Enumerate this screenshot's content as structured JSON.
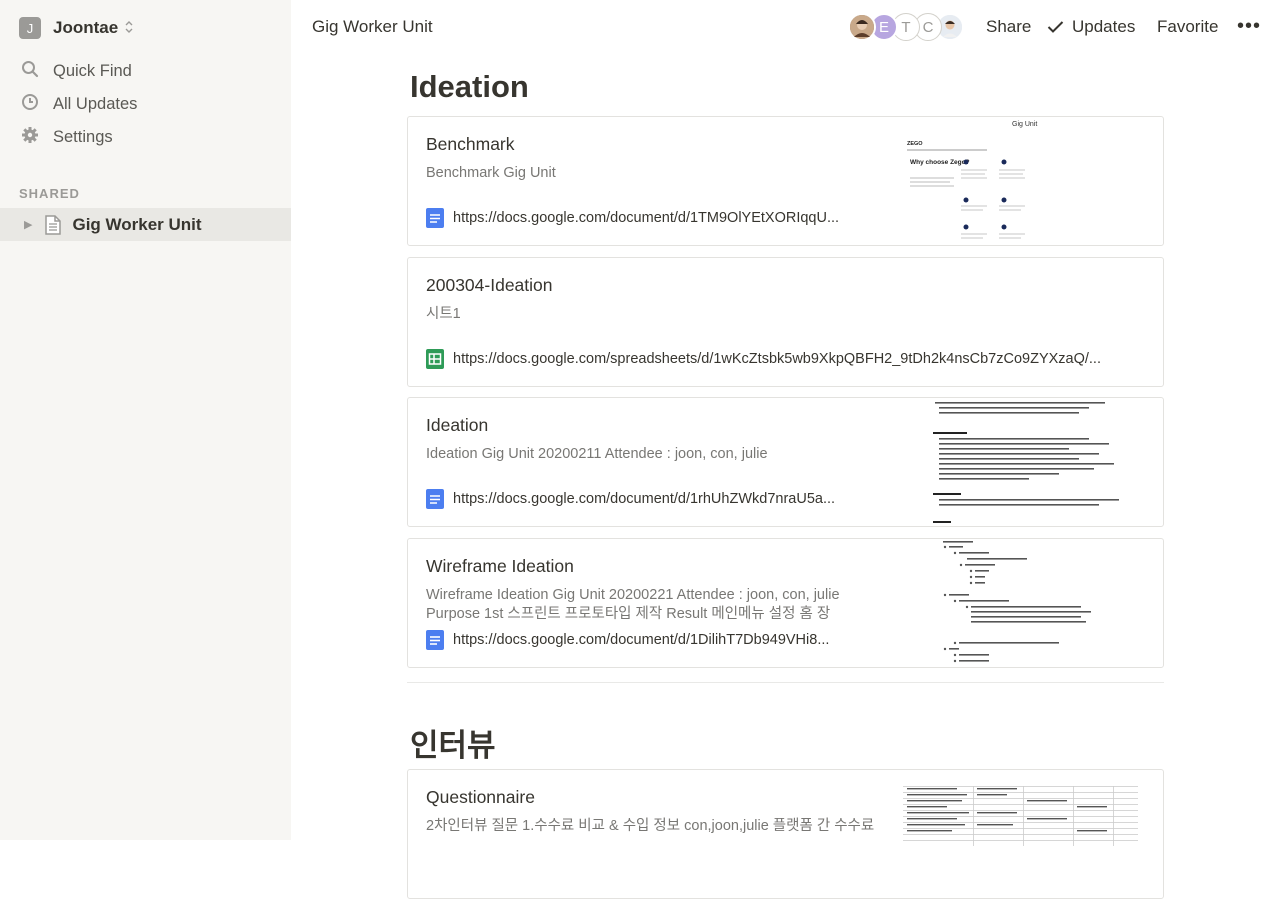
{
  "sidebar": {
    "workspace": {
      "initial": "J",
      "name": "Joontae"
    },
    "nav": [
      {
        "label": "Quick Find",
        "icon": "search-icon"
      },
      {
        "label": "All Updates",
        "icon": "clock-icon"
      },
      {
        "label": "Settings",
        "icon": "gear-icon"
      }
    ],
    "section_label": "SHARED",
    "pages": [
      {
        "label": "Gig Worker Unit"
      }
    ]
  },
  "topbar": {
    "breadcrumb": "Gig Worker Unit",
    "collaborators": [
      "E",
      "T",
      "C"
    ],
    "share": "Share",
    "updates": "Updates",
    "favorite": "Favorite",
    "more": "•••"
  },
  "sections": [
    {
      "heading": "Ideation",
      "cards": [
        {
          "title": "Benchmark",
          "subtitle": "Benchmark Gig Unit",
          "link": "https://docs.google.com/document/d/1TM9OlYEtXORIqqU...",
          "icon": "google-docs-icon",
          "thumb": {
            "title": "Gig Unit",
            "brand": "ZEGO",
            "heading": "Why choose Zego?"
          }
        },
        {
          "title": "200304-Ideation",
          "subtitle": "시트1",
          "link": "https://docs.google.com/spreadsheets/d/1wKcZtsbk5wb9XkpQBFH2_9tDh2k4nsCb7zCo9ZYXzaQ/...",
          "icon": "google-sheets-icon"
        },
        {
          "title": "Ideation",
          "subtitle": "Ideation Gig Unit 20200211 Attendee : joon, con, julie",
          "link": "https://docs.google.com/document/d/1rhUhZWkd7nraU5a...",
          "icon": "google-docs-icon"
        },
        {
          "title": "Wireframe Ideation",
          "subtitle": "Wireframe Ideation Gig Unit 20200221 Attendee : joon, con, julie Purpose 1st 스프린트 프로토타입 제작 Result 메인메뉴 설정 홈 장",
          "link": "https://docs.google.com/document/d/1DilihT7Db949VHi8...",
          "icon": "google-docs-icon"
        }
      ]
    },
    {
      "heading": "인터뷰",
      "cards": [
        {
          "title": "Questionnaire",
          "subtitle": "2차인터뷰 질문 1.수수료 비교 & 수입 정보 con,joon,julie 플랫폼 간 수수료",
          "link": "",
          "icon": "google-docs-icon"
        }
      ]
    }
  ],
  "colors": {
    "docs_blue": "#4c7ef0",
    "sheets_green": "#2e9b57",
    "sidebar_bg": "#f7f6f3",
    "selected_bg": "#e9e8e4"
  }
}
